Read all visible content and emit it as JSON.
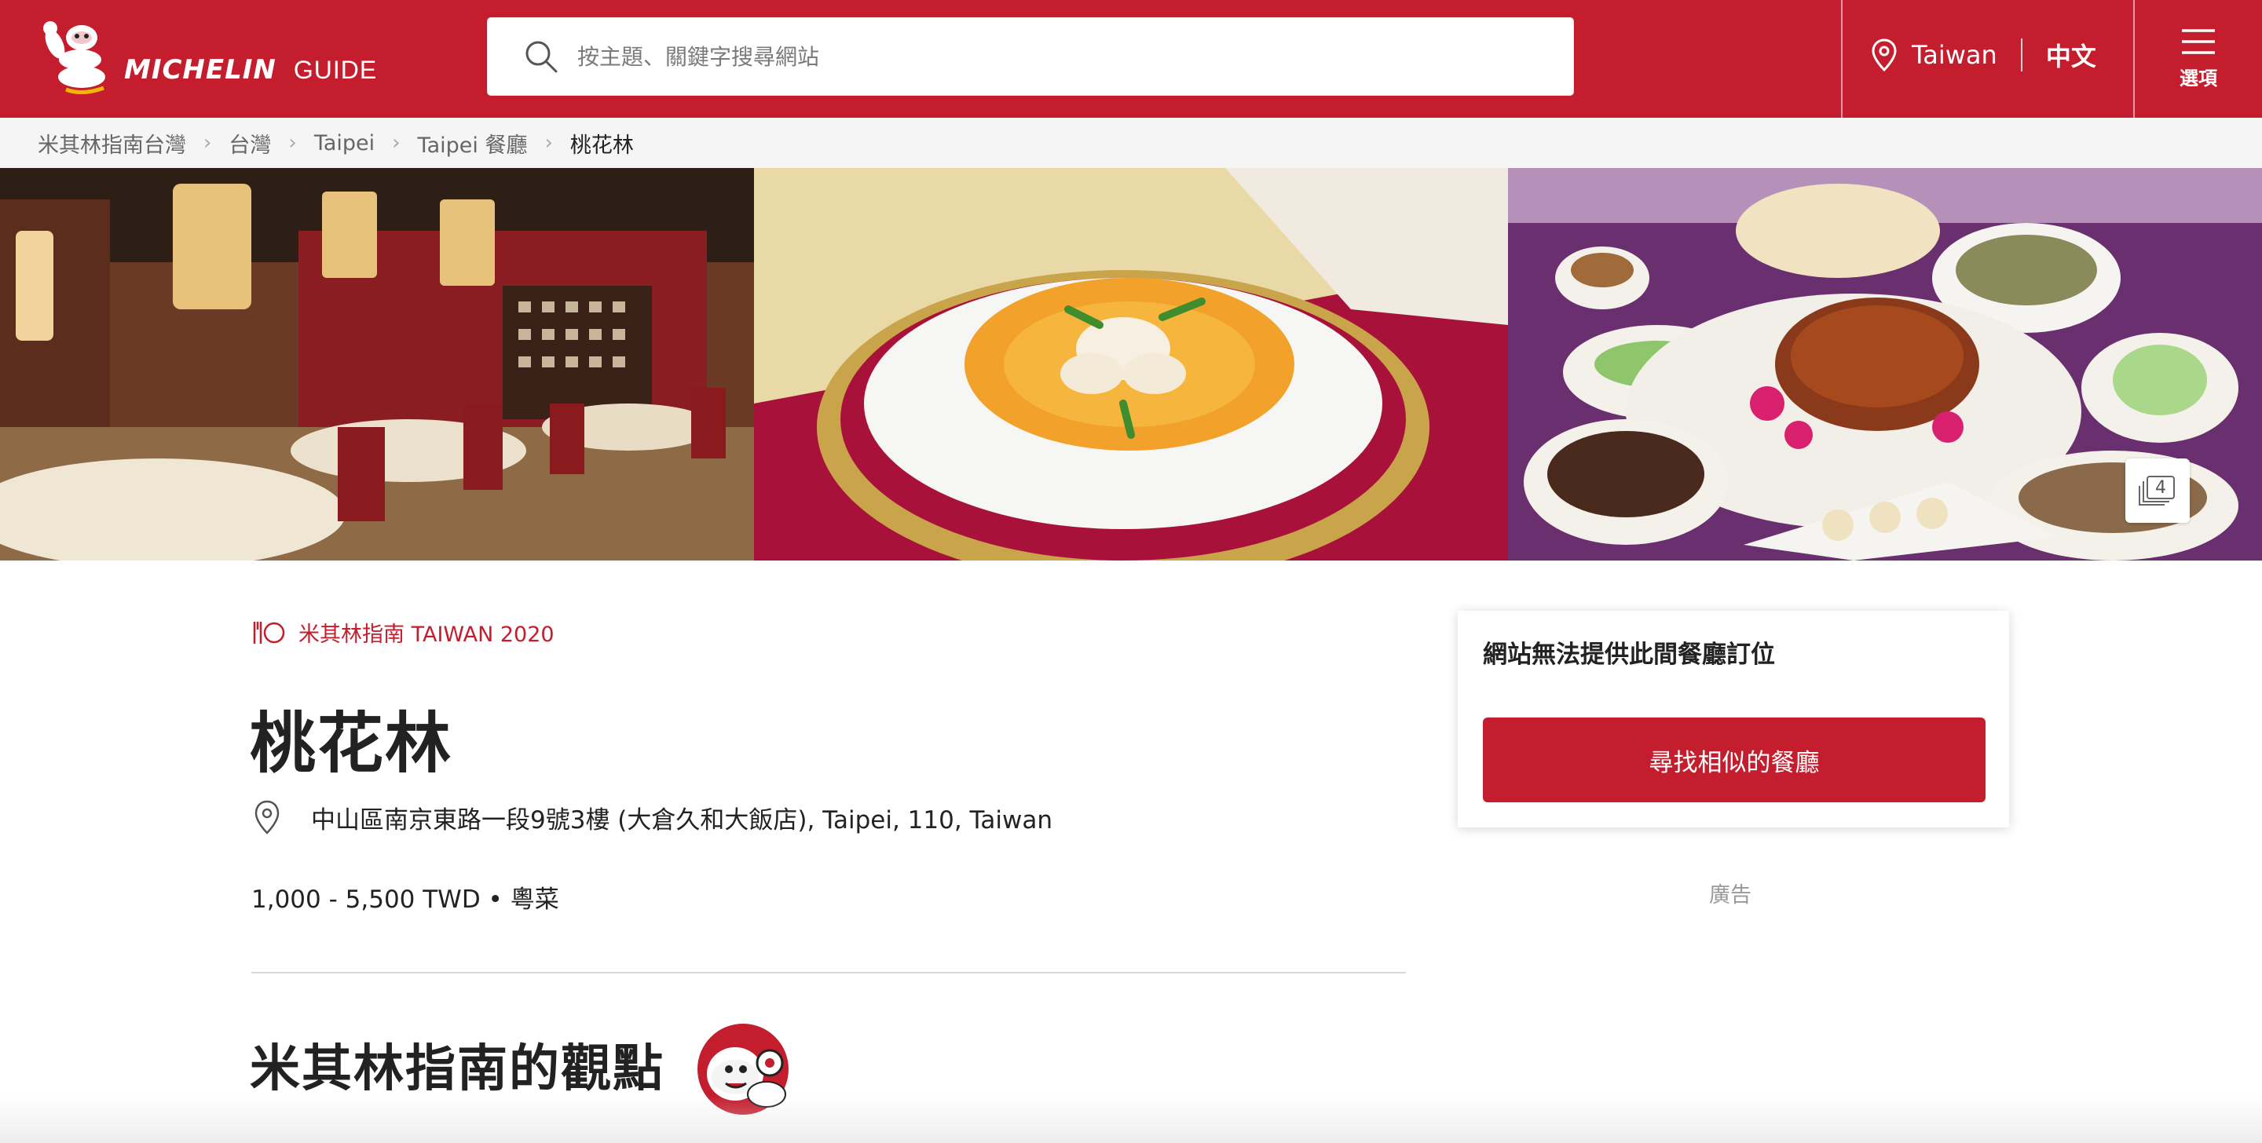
{
  "header": {
    "brand_word": "MICHELIN",
    "brand_guide": "GUIDE",
    "search_placeholder": "按主題、關鍵字搜尋網站",
    "region": "Taiwan",
    "language": "中文",
    "menu_label": "選項"
  },
  "breadcrumb": [
    "米其林指南台灣",
    "台灣",
    "Taipei",
    "Taipei 餐廳",
    "桃花林"
  ],
  "gallery": {
    "photo_count": "4"
  },
  "restaurant": {
    "distinction": "米其林指南 TAIWAN 2020",
    "name": "桃花林",
    "address": "中山區南京東路一段9號3樓 (大倉久和大飯店), Taipei, 110, Taiwan",
    "price_cuisine": "1,000 - 5,500 TWD • 粵菜"
  },
  "section": {
    "title": "米其林指南的觀點"
  },
  "booking": {
    "title": "網站無法提供此間餐廳訂位",
    "button": "尋找相似的餐廳",
    "ad_label": "廣告"
  },
  "colors": {
    "brand_red": "#c41e2e",
    "breadcrumb_bg": "#f5f5f5"
  }
}
